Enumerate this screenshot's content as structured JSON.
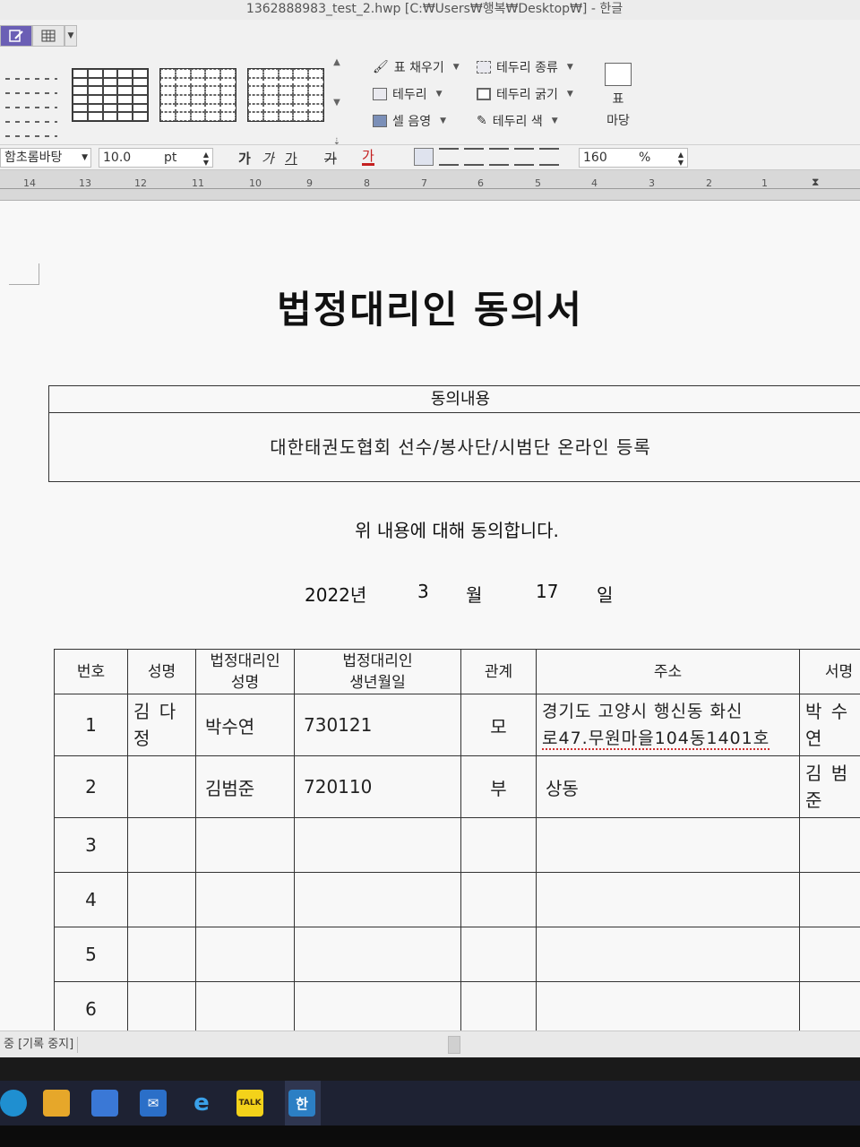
{
  "window": {
    "title": "1362888983_test_2.hwp [C:₩Users₩행복₩Desktop₩] - 한글"
  },
  "ribbon": {
    "fill_label": "표 채우기",
    "border_label": "테두리",
    "shade_label": "셀 음영",
    "border_type_label": "테두리 종류",
    "border_width_label": "테두리 굵기",
    "border_color_label": "테두리 색",
    "table_margin_label_1": "표",
    "table_margin_label_2": "마당"
  },
  "format": {
    "font_name": "함초롬바탕",
    "font_size": "10.0",
    "font_unit": "pt",
    "bold": "가",
    "italic": "가",
    "underline": "가",
    "strike": "가",
    "color_char": "가",
    "line_spacing": "160",
    "line_spacing_unit": "%"
  },
  "ruler": {
    "ticks": [
      "14",
      "13",
      "12",
      "11",
      "10",
      "9",
      "8",
      "7",
      "6",
      "5",
      "4",
      "3",
      "2",
      "1"
    ]
  },
  "document": {
    "title": "법정대리인 동의서",
    "consent_header": "동의내용",
    "consent_body": "대한태권도협회 선수/봉사단/시범단 온라인 등록",
    "agree_text": "위 내용에 대해 동의합니다.",
    "date": {
      "year": "2022년",
      "month": "3",
      "month_label": "월",
      "day": "17",
      "day_label": "일"
    },
    "table": {
      "headers": [
        "번호",
        "성명",
        "법정대리인\n성명",
        "법정대리인\n생년월일",
        "관계",
        "주소",
        "서명"
      ],
      "rows": [
        {
          "no": "1",
          "name": "김 다 정",
          "guardian": "박수연",
          "birth": "730121",
          "relation": "모",
          "address_1": "경기도 고양시 행신동 화신",
          "address_2": "로47.무원마을104동1401호",
          "sign": "박 수 연"
        },
        {
          "no": "2",
          "name": "",
          "guardian": "김범준",
          "birth": "720110",
          "relation": "부",
          "address_1": "상동",
          "address_2": "",
          "sign": "김 범 준"
        },
        {
          "no": "3",
          "name": "",
          "guardian": "",
          "birth": "",
          "relation": "",
          "address_1": "",
          "address_2": "",
          "sign": ""
        },
        {
          "no": "4",
          "name": "",
          "guardian": "",
          "birth": "",
          "relation": "",
          "address_1": "",
          "address_2": "",
          "sign": ""
        },
        {
          "no": "5",
          "name": "",
          "guardian": "",
          "birth": "",
          "relation": "",
          "address_1": "",
          "address_2": "",
          "sign": ""
        },
        {
          "no": "6",
          "name": "",
          "guardian": "",
          "birth": "",
          "relation": "",
          "address_1": "",
          "address_2": "",
          "sign": ""
        }
      ]
    }
  },
  "status": {
    "text": "중 [기록 중지]"
  },
  "taskbar": {
    "icons": [
      "edge-browser-icon",
      "file-explorer-icon",
      "store-icon",
      "mail-icon",
      "internet-explorer-icon",
      "kakaotalk-icon",
      "hangul-icon"
    ],
    "kakao_label": "TALK",
    "hangul_label": "한"
  },
  "colors": {
    "accent": "#6b5fb5",
    "taskbar": "#1e2233",
    "squiggle": "#d03030"
  }
}
